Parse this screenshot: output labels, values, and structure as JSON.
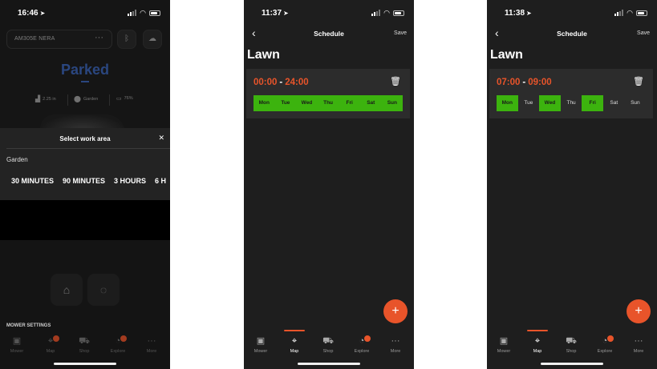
{
  "colors": {
    "accent": "#e8542a",
    "status_blue": "#3c6fd6",
    "day_active": "#3cb30e"
  },
  "screen1": {
    "status_time": "16:46",
    "mower_name": "AM305E NERA",
    "status": "Parked",
    "stats": {
      "cut_height": "2.25 in",
      "area": "Garden",
      "battery": "76%"
    },
    "sheet": {
      "title": "Select work area",
      "area": "Garden",
      "durations": [
        "30 MINUTES",
        "90 MINUTES",
        "3 HOURS",
        "6 H"
      ]
    },
    "settings_label": "MOWER SETTINGS"
  },
  "screen2": {
    "status_time": "11:37",
    "title": "Schedule",
    "save": "Save",
    "zone": "Lawn",
    "start": "00:00",
    "end": "24:00",
    "days": [
      {
        "label": "Mon",
        "on": true
      },
      {
        "label": "Tue",
        "on": true
      },
      {
        "label": "Wed",
        "on": true
      },
      {
        "label": "Thu",
        "on": true
      },
      {
        "label": "Fri",
        "on": true
      },
      {
        "label": "Sat",
        "on": true
      },
      {
        "label": "Sun",
        "on": true
      }
    ]
  },
  "screen3": {
    "status_time": "11:38",
    "title": "Schedule",
    "save": "Save",
    "zone": "Lawn",
    "start": "07:00",
    "end": "09:00",
    "days": [
      {
        "label": "Mon",
        "on": true
      },
      {
        "label": "Tue",
        "on": false
      },
      {
        "label": "Wed",
        "on": true
      },
      {
        "label": "Thu",
        "on": false
      },
      {
        "label": "Fri",
        "on": true
      },
      {
        "label": "Sat",
        "on": false
      },
      {
        "label": "Sun",
        "on": false
      }
    ]
  },
  "tabs": [
    {
      "label": "Mower",
      "icon": "mower-icon"
    },
    {
      "label": "Map",
      "icon": "map-pin-icon"
    },
    {
      "label": "Shop",
      "icon": "cart-icon"
    },
    {
      "label": "Explore",
      "icon": "lightbulb-icon"
    },
    {
      "label": "More",
      "icon": "more-icon"
    }
  ]
}
